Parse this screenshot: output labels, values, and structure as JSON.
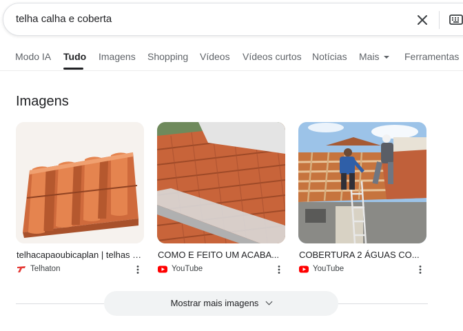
{
  "search": {
    "query": "telha calha e coberta"
  },
  "tabs": [
    {
      "label": "Modo IA"
    },
    {
      "label": "Tudo"
    },
    {
      "label": "Imagens"
    },
    {
      "label": "Shopping"
    },
    {
      "label": "Vídeos"
    },
    {
      "label": "Vídeos curtos"
    },
    {
      "label": "Notícias"
    },
    {
      "label": "Mais"
    },
    {
      "label": "Ferramentas"
    }
  ],
  "section": {
    "title": "Imagens"
  },
  "images": [
    {
      "caption": "telhacapaoubicaplan | telhas | ...",
      "source": "Telhaton",
      "source_icon": "telhaton-logo-icon"
    },
    {
      "caption": "COMO E FEITO UM ACABA...",
      "source": "YouTube",
      "source_icon": "youtube-icon"
    },
    {
      "caption": "COBERTURA 2 ÁGUAS CO...",
      "source": "YouTube",
      "source_icon": "youtube-icon"
    }
  ],
  "more_button": {
    "label": "Mostrar mais imagens"
  },
  "colors": {
    "accent_text": "#202124",
    "muted_text": "#5f6368",
    "youtube_red": "#ff0000",
    "telhaton_red": "#e53935"
  }
}
